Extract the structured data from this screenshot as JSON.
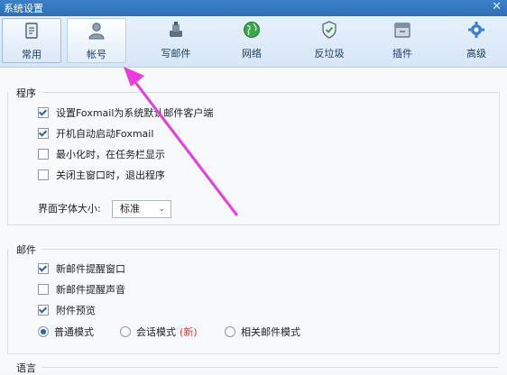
{
  "window": {
    "title": "系统设置",
    "close_glyph": "✕"
  },
  "toolbar": {
    "tabs": [
      {
        "label": "常用",
        "icon": "document-icon"
      },
      {
        "label": "帐号",
        "icon": "user-icon"
      },
      {
        "label": "写邮件",
        "icon": "compose-icon"
      },
      {
        "label": "网络",
        "icon": "globe-icon"
      },
      {
        "label": "反垃圾",
        "icon": "shield-icon"
      },
      {
        "label": "插件",
        "icon": "plugin-box-icon"
      },
      {
        "label": "高级",
        "icon": "gear-icon"
      }
    ],
    "active": "常用",
    "highlighted": "帐号"
  },
  "program": {
    "title": "程序",
    "options": [
      {
        "label": "设置Foxmail为系统默认邮件客户端",
        "checked": true
      },
      {
        "label": "开机自动启动Foxmail",
        "checked": true
      },
      {
        "label": "最小化时，在任务栏显示",
        "checked": false
      },
      {
        "label": "关闭主窗口时，退出程序",
        "checked": false
      }
    ],
    "font_size_label": "界面字体大小:",
    "font_size_value": "标准",
    "dropdown_glyph": "⌄"
  },
  "mail": {
    "title": "邮件",
    "options": [
      {
        "label": "新邮件提醒窗口",
        "checked": true
      },
      {
        "label": "新邮件提醒声音",
        "checked": false
      },
      {
        "label": "附件预览",
        "checked": true
      }
    ],
    "modes": [
      {
        "label": "普通模式",
        "checked": true
      },
      {
        "label": "会话模式",
        "checked": false,
        "badge": "(新)"
      },
      {
        "label": "相关邮件模式",
        "checked": false
      }
    ]
  },
  "language": {
    "title": "语言"
  },
  "colors": {
    "arrow": "#e93ce0",
    "accent": "#2a63b0",
    "titlebar": "#3577c2"
  }
}
